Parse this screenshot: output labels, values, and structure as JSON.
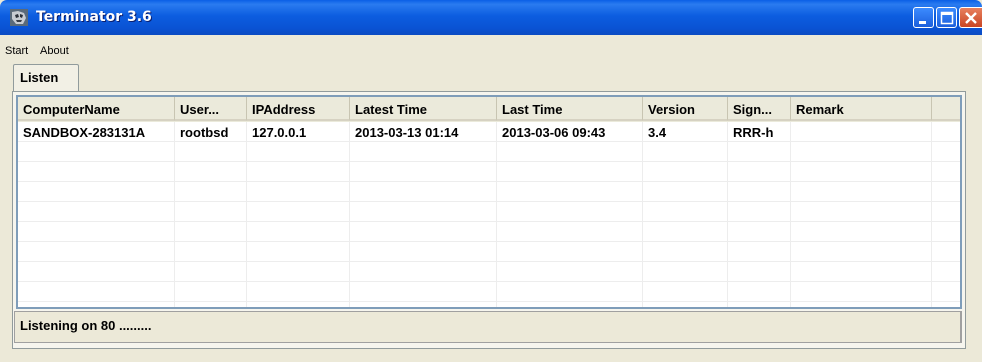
{
  "window": {
    "title": "Terminator 3.6"
  },
  "menu": {
    "items": [
      "Start",
      "About"
    ]
  },
  "tabs": [
    {
      "label": "Listen"
    }
  ],
  "table": {
    "columns": [
      "ComputerName",
      "User...",
      "IPAddress",
      "Latest Time",
      "Last Time",
      "Version",
      "Sign...",
      "Remark"
    ],
    "rows": [
      [
        "SANDBOX-283131A",
        "rootbsd",
        "127.0.0.1",
        "2013-03-13 01:14",
        "2013-03-06 09:43",
        "3.4",
        "RRR-h",
        ""
      ]
    ]
  },
  "status": {
    "text": "Listening on 80 ........."
  }
}
